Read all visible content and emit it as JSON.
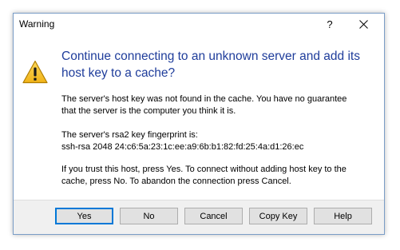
{
  "window": {
    "title": "Warning",
    "help_glyph": "?",
    "close_icon": "close-icon"
  },
  "icon": "warning-triangle-icon",
  "instruction": {
    "line1": "Continue connecting to an unknown server and add its",
    "line2": "host key to a cache?"
  },
  "message": {
    "p1_line1": "The server's host key was not found in the cache. You have no guarantee",
    "p1_line2": "that the server is the computer you think it is.",
    "p2_line1": "The server's rsa2 key fingerprint is:",
    "p2_line2": "ssh-rsa 2048 24:c6:5a:23:1c:ee:a9:6b:b1:82:fd:25:4a:d1:26:ec",
    "p3_line1": "If you trust this host, press Yes. To connect without adding host key to the",
    "p3_line2": "cache, press No. To abandon the connection press Cancel."
  },
  "buttons": {
    "yes": "Yes",
    "no": "No",
    "cancel": "Cancel",
    "copy_key": "Copy Key",
    "help": "Help"
  },
  "colors": {
    "instruction_text": "#1f3d9b",
    "default_button_border": "#0078d7",
    "warning_fill": "#f8c42e"
  }
}
